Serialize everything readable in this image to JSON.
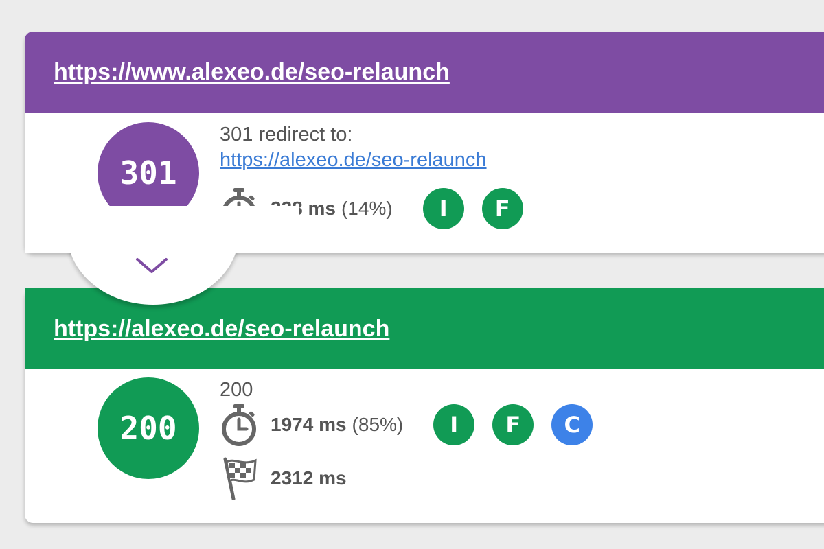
{
  "hops": [
    {
      "url": "https://www.alexeo.de/seo-relaunch",
      "status_code": "301",
      "status_text": "301 redirect to:",
      "redirect_target": "https://alexeo.de/seo-relaunch",
      "time": "338 ms",
      "time_pct": "(14%)",
      "badges": [
        "I",
        "F"
      ],
      "color": "#7e4ca3"
    },
    {
      "url": "https://alexeo.de/seo-relaunch",
      "status_code": "200",
      "status_text": "200",
      "time": "1974 ms",
      "time_pct": "(85%)",
      "badges": [
        "I",
        "F",
        "C"
      ],
      "total_time": "2312 ms",
      "color": "#119b55"
    }
  ],
  "icons": {
    "timer": "stopwatch-icon",
    "finish": "checkered-flag-icon",
    "expand": "chevron-down-icon"
  },
  "colors": {
    "redirect": "#7e4ca3",
    "ok": "#119b55",
    "badge_blue": "#3d82e8",
    "link": "#3a7bd5"
  }
}
